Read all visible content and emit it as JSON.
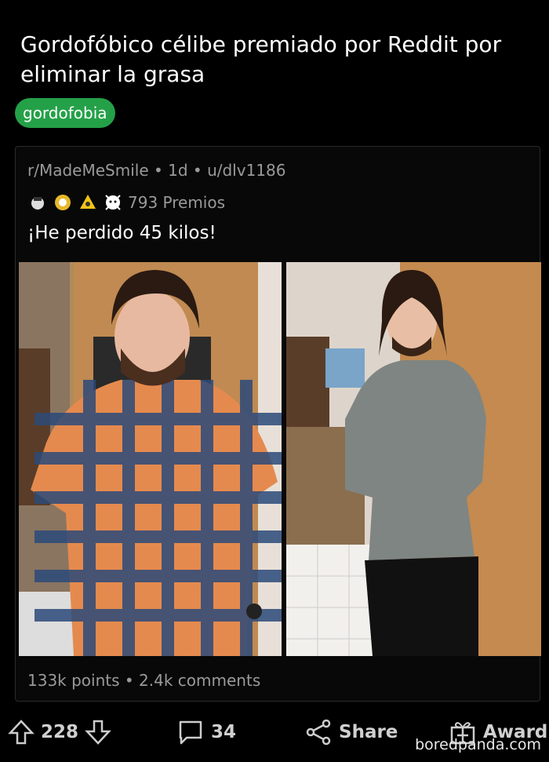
{
  "post": {
    "title": "Gordofóbico célibe premiado por Reddit por eliminar la grasa",
    "flair": "gordofobia"
  },
  "card": {
    "meta": "r/MadeMeSmile • 1d • u/dlv1186",
    "awards_count": "793 Premios",
    "text": "¡He perdido 45 kilos!",
    "stats": "133k points • 2.4k comments",
    "photos": [
      "before-photo",
      "after-photo"
    ]
  },
  "actions": {
    "upvotes": "228",
    "comments": "34",
    "share": "Share",
    "award": "Award"
  },
  "watermark": "boredpanda.com",
  "colors": {
    "flair_bg": "#24a148",
    "meta_text": "#9a9a9a"
  }
}
